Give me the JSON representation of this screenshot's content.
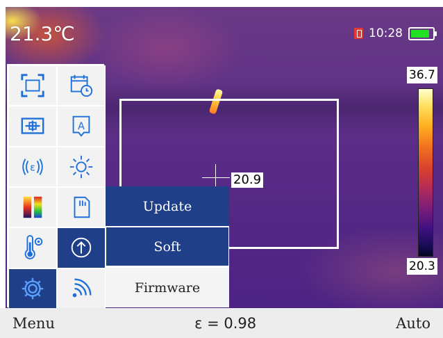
{
  "thermal_view": {
    "ambient_temperature": "21.3℃",
    "clock": "10:28",
    "center_point_value": "20.9",
    "scale_max": "36.7",
    "scale_min": "20.3",
    "battery_level": 0.85
  },
  "menu_grid": [
    {
      "icon": "region-frame-icon"
    },
    {
      "icon": "calendar-clock-icon"
    },
    {
      "icon": "center-point-icon"
    },
    {
      "icon": "text-annotation-icon"
    },
    {
      "icon": "emissivity-icon"
    },
    {
      "icon": "brightness-icon"
    },
    {
      "icon": "palette-icon"
    },
    {
      "icon": "sd-card-icon"
    },
    {
      "icon": "temperature-settings-icon"
    },
    {
      "icon": "update-arrow-icon"
    },
    {
      "icon": "settings-gear-icon"
    },
    {
      "icon": "wifi-signal-icon"
    }
  ],
  "submenu": {
    "items": [
      {
        "label": "Update",
        "style": "blue"
      },
      {
        "label": "Soft",
        "style": "blue",
        "selected": true
      },
      {
        "label": "Firmware",
        "style": "plain"
      }
    ]
  },
  "footer": {
    "left": "Menu",
    "center": "ε = 0.98",
    "right": "Auto"
  }
}
